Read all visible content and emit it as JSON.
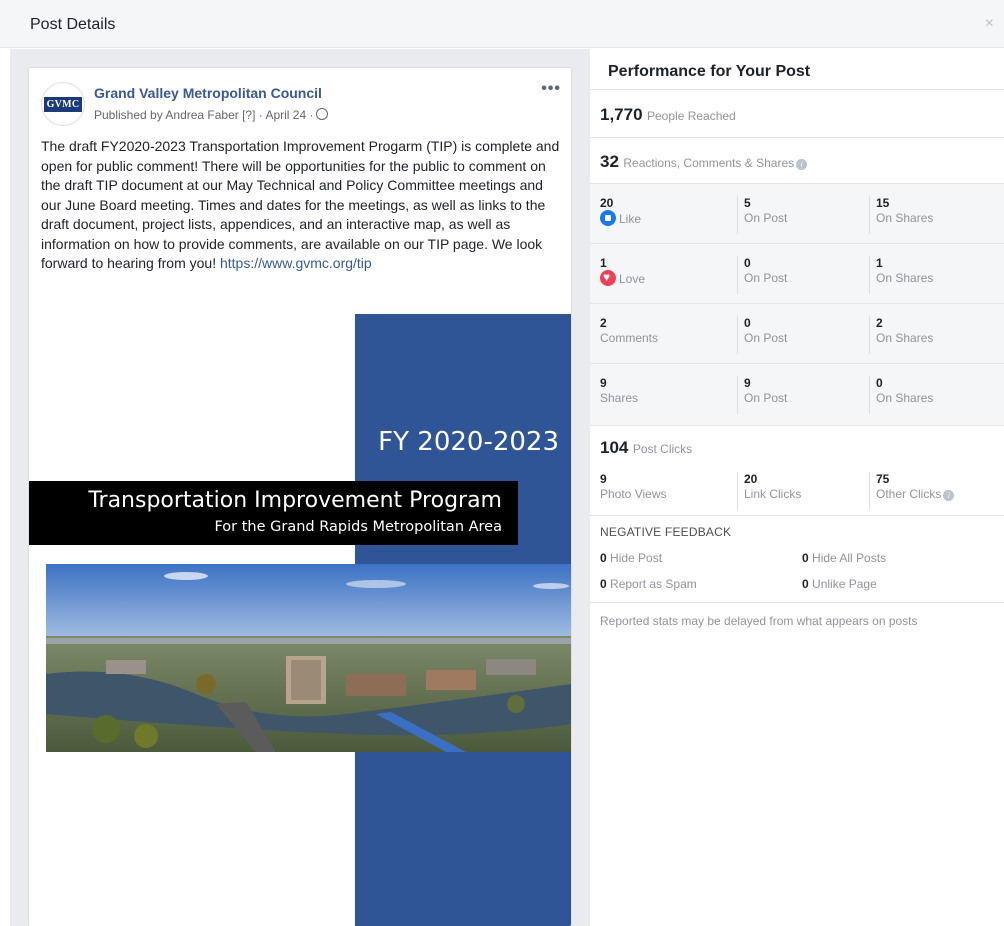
{
  "dialog": {
    "title": "Post Details",
    "close_label": "×"
  },
  "post": {
    "avatar_text": "GVMC",
    "page_name": "Grand Valley Metropolitan Council",
    "byline": "Published by Andrea Faber [?] · April 24 ·",
    "more_label": "•••",
    "text": "The draft FY2020-2023 Transportation Improvement Progarm (TIP) is complete and open for public comment! There will be opportunities for the public to comment on the draft TIP document at our May Technical and Policy Committee meetings and our June Board meeting. Times and dates for the meetings, as well as links to the draft document, project lists, appendices, and an interactive map, as well as information on how to provide comments, are available on our TIP page. We look forward to hearing from you!",
    "link": "https://www.gvmc.org/tip",
    "cover": {
      "fy": "FY 2020-2023",
      "title": "Transportation Improvement Program",
      "subtitle": "For the Grand Rapids Metropolitan Area",
      "band_color": "#2f5597"
    }
  },
  "performance": {
    "title": "Performance for Your Post",
    "reached_value": "1,770",
    "reached_label": "People Reached",
    "reactions_value": "32",
    "reactions_label": "Reactions, Comments & Shares",
    "rows": [
      {
        "n": "20",
        "label": "Like",
        "icon": "like-icon",
        "post_n": "5",
        "post_label": "On Post",
        "shares_n": "15",
        "shares_label": "On Shares"
      },
      {
        "n": "1",
        "label": "Love",
        "icon": "love-icon",
        "post_n": "0",
        "post_label": "On Post",
        "shares_n": "1",
        "shares_label": "On Shares"
      },
      {
        "n": "2",
        "label": "Comments",
        "post_n": "0",
        "post_label": "On Post",
        "shares_n": "2",
        "shares_label": "On Shares"
      },
      {
        "n": "9",
        "label": "Shares",
        "post_n": "9",
        "post_label": "On Post",
        "shares_n": "0",
        "shares_label": "On Shares"
      }
    ],
    "clicks_value": "104",
    "clicks_label": "Post Clicks",
    "clicks": [
      {
        "n": "9",
        "label": "Photo Views"
      },
      {
        "n": "20",
        "label": "Link Clicks"
      },
      {
        "n": "75",
        "label": "Other Clicks"
      }
    ],
    "negative": {
      "title": "NEGATIVE FEEDBACK",
      "hide_post_n": "0",
      "hide_post": "Hide Post",
      "hide_all_n": "0",
      "hide_all": "Hide All Posts",
      "spam_n": "0",
      "spam": "Report as Spam",
      "unlike_n": "0",
      "unlike": "Unlike Page"
    },
    "note": "Reported stats may be delayed from what appears on posts",
    "accent_color": "#1877f2",
    "love_color": "#f33e58"
  }
}
